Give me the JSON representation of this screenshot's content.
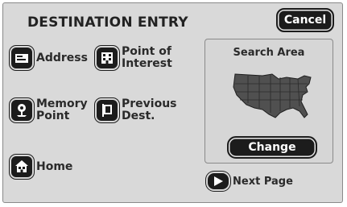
{
  "header": {
    "title": "DESTINATION ENTRY",
    "cancel_label": "Cancel"
  },
  "menu": {
    "address": {
      "label_line1": "Address",
      "label_line2": "",
      "icon": "address-card-icon"
    },
    "poi": {
      "label_line1": "Point of",
      "label_line2": "Interest",
      "icon": "building-icon"
    },
    "memory": {
      "label_line1": "Memory",
      "label_line2": "Point",
      "icon": "memory-point-icon"
    },
    "previous": {
      "label_line1": "Previous",
      "label_line2": "Dest.",
      "icon": "flag-icon"
    },
    "home": {
      "label_line1": "Home",
      "label_line2": "",
      "icon": "home-icon"
    }
  },
  "search_area": {
    "title": "Search Area",
    "change_label": "Change",
    "map_icon": "usa-map-icon"
  },
  "footer": {
    "next_page_label": "Next Page",
    "icon": "arrow-right-icon"
  },
  "colors": {
    "background": "#d9d9d9",
    "button": "#1c1c1c",
    "text": "#2a2a2a"
  }
}
